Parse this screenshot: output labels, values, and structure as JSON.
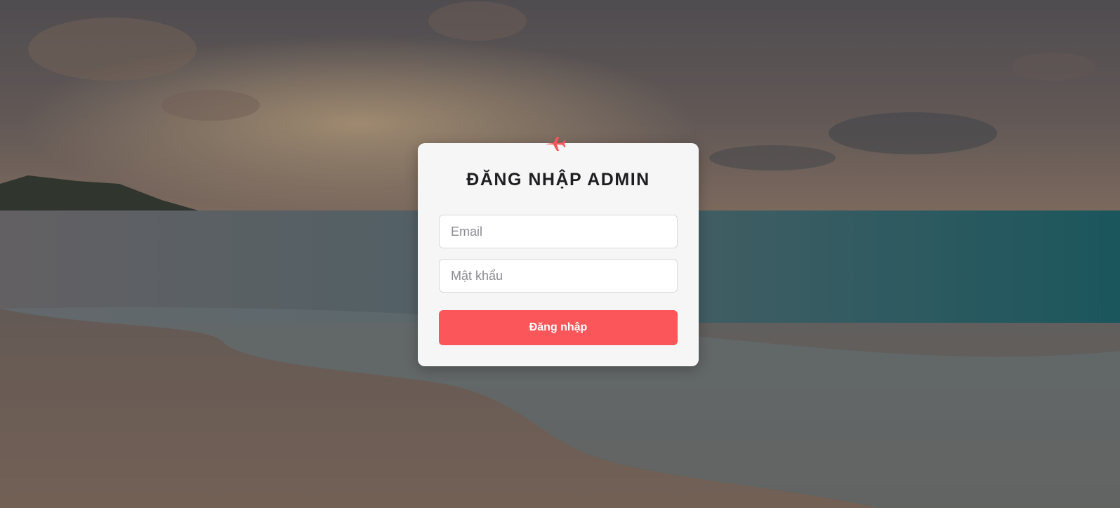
{
  "login": {
    "title": "ĐĂNG NHẬP ADMIN",
    "email_placeholder": "Email",
    "password_placeholder": "Mật khẩu",
    "submit_label": "Đăng nhập",
    "icon": "airplane-icon"
  },
  "colors": {
    "accent": "#fb5659",
    "card_background": "#f6f6f7",
    "title_text": "#1f1f22"
  },
  "background": {
    "scene": "beach-sunset-photo"
  }
}
